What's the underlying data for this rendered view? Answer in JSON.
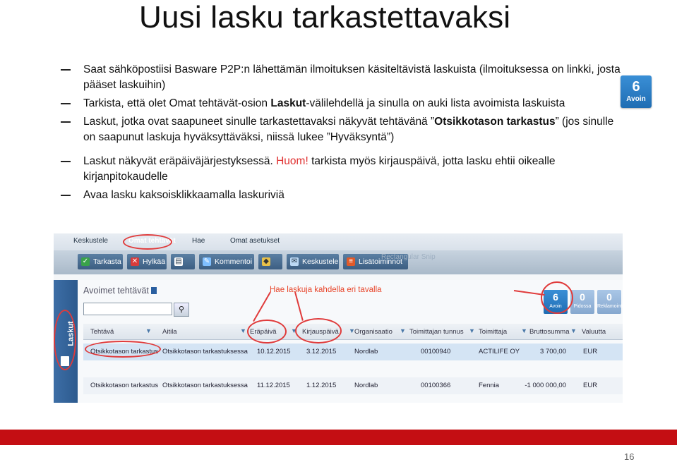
{
  "title": "Uusi lasku tarkastettavaksi",
  "bullets": [
    {
      "text": "Saat sähköpostiisi Basware P2P:n lähettämän ilmoituksen käsiteltävistä laskuista (ilmoituksessa on linkki, josta pääset laskuihin)"
    },
    {
      "pre": "Tarkista, että olet Omat tehtävät-osion ",
      "bold": "Laskut",
      "post": "-välilehdellä ja sinulla on auki lista avoimista laskuista"
    },
    {
      "pre": "Laskut, jotka ovat saapuneet sinulle tarkastettavaksi näkyvät tehtävänä ”",
      "bold": "Otsikkotason tarkastus",
      "post": "” (jos sinulle on saapunut laskuja hyväksyttäväksi, niissä lukee ”Hyväksyntä”)"
    },
    {
      "pre": "Laskut näkyvät eräpäiväjärjestyksessä. ",
      "red": "Huom!",
      "post": " tarkista myös kirjauspäivä, jotta lasku ehtii oikealle kirjanpitokaudelle"
    },
    {
      "text": "Avaa lasku kaksoisklikkaamalla laskuriviä"
    }
  ],
  "badge": {
    "count": "6",
    "label": "Avoin"
  },
  "screenshot": {
    "menu": [
      "Keskustele",
      "Omat tehtävät",
      "Hae",
      "Omat asetukset"
    ],
    "toolbar": [
      "Tarkasta",
      "Hylkää",
      "",
      "Kommentoi",
      "",
      "Keskustele",
      "Lisätoiminnot"
    ],
    "ghost": "Rectangular Snip",
    "panel_title": "Avoimet tehtävät",
    "sidebar_label": "Laskut",
    "note": "Hae laskuja kahdella eri tavalla",
    "tiles": [
      {
        "count": "6",
        "label": "Avoin"
      },
      {
        "count": "0",
        "label": "Pidossa"
      },
      {
        "count": "0",
        "label": "Reklamointi"
      }
    ],
    "columns": [
      "Tehtävä",
      "Aitila",
      "Eräpäivä",
      "Kirjauspäivä",
      "Organisaatio",
      "Toimittajan tunnus",
      "Toimittaja",
      "Bruttosumma",
      "Valuutta"
    ],
    "rows": [
      [
        "Otsikkotason tarkastus",
        "Otsikkotason tarkastuksessa",
        "10.12.2015",
        "3.12.2015",
        "Nordlab",
        "00100940",
        "ACTILIFE OY",
        "3 700,00",
        "EUR"
      ],
      [
        "Otsikkotason tarkastus",
        "Otsikkotason tarkastuksessa",
        "11.12.2015",
        "1.12.2015",
        "Nordlab",
        "00100366",
        "Fennia",
        "-1 000 000,00",
        "EUR"
      ]
    ]
  },
  "page_number": "16",
  "colors": {
    "accent_red": "#c40e13",
    "highlight_red": "#e03030",
    "badge_blue": "#2a78c6"
  }
}
